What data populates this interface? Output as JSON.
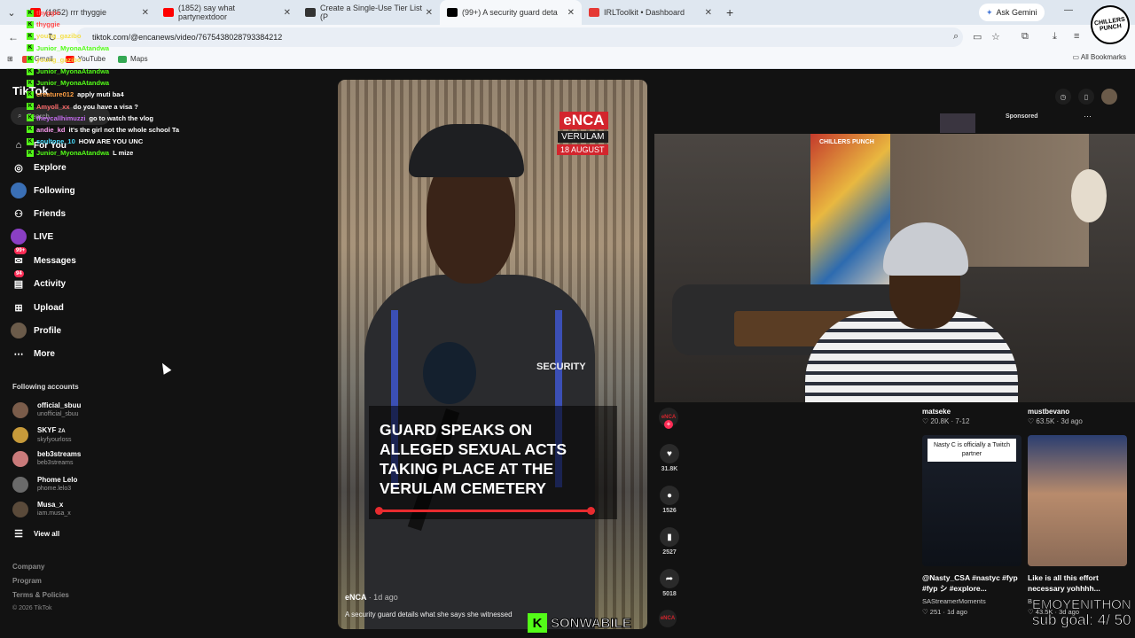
{
  "browser": {
    "tabs": [
      {
        "title": "(1852) rrr thyggie",
        "color": "#ff0000"
      },
      {
        "title": "(1852) say what partynextdoor",
        "color": "#ff0000"
      },
      {
        "title": "Create a Single-Use Tier List (P",
        "color": "#333333"
      },
      {
        "title": "(99+) A security guard deta",
        "color": "#000000"
      },
      {
        "title": "IRLToolkit • Dashboard",
        "color": "#e53935"
      }
    ],
    "new_tab": "+",
    "ask_gemini": "Ask Gemini",
    "url": "tiktok.com/@encanews/video/7675438028793384212",
    "bookmarks": [
      "Gmail",
      "YouTube",
      "Maps"
    ],
    "all_bookmarks": "All Bookmarks"
  },
  "chat": [
    {
      "user": "thyggie",
      "msg": "",
      "color": "#ff4d4d"
    },
    {
      "user": "thyggie",
      "msg": "",
      "color": "#ff4d4d"
    },
    {
      "user": "young_gazibo",
      "msg": "",
      "color": "#f4e04d"
    },
    {
      "user": "Junior_MyonaAtandwa",
      "msg": "",
      "color": "#53fc18"
    },
    {
      "user": "young_gazibo",
      "msg": "",
      "color": "#f4e04d"
    },
    {
      "user": "Junior_MyonaAtandwa",
      "msg": "",
      "color": "#53fc18"
    },
    {
      "user": "Junior_MyonaAtandwa",
      "msg": "",
      "color": "#53fc18"
    },
    {
      "user": "creature012",
      "msg": "apply muti ba4",
      "color": "#ff9f43"
    },
    {
      "user": "Amyoll_xx",
      "msg": "do you have a visa ?",
      "color": "#ff6b6b"
    },
    {
      "user": "theycallhimuzzi",
      "msg": "go to watch the vlog",
      "color": "#c56cf0"
    },
    {
      "user": "andie_kd",
      "msg": "it's the girl not the whole school Ta",
      "color": "#ff9ff3"
    },
    {
      "user": "soultone_10",
      "msg": "HOW ARE YOU UNC",
      "color": "#48dbfb"
    },
    {
      "user": "Junior_MyonaAtandwa",
      "msg": "L mize",
      "color": "#53fc18"
    }
  ],
  "sidebar": {
    "logo": "TikTok",
    "search_placeholder": "Search",
    "items": [
      {
        "label": "For You",
        "icon": "home-icon"
      },
      {
        "label": "Explore",
        "icon": "compass-icon"
      },
      {
        "label": "Following",
        "icon": "following-icon"
      },
      {
        "label": "Friends",
        "icon": "friends-icon"
      },
      {
        "label": "LIVE",
        "icon": "live-icon"
      },
      {
        "label": "Messages",
        "icon": "messages-icon",
        "badge": "99+"
      },
      {
        "label": "Activity",
        "icon": "activity-icon",
        "badge": "94"
      },
      {
        "label": "Upload",
        "icon": "upload-icon"
      },
      {
        "label": "Profile",
        "icon": "profile-icon"
      },
      {
        "label": "More",
        "icon": "more-icon"
      }
    ],
    "following_title": "Following accounts",
    "accounts": [
      {
        "name": "official_sbuu",
        "handle": "unofficial_sbuu",
        "color": "#7a5c4a"
      },
      {
        "name": "SKYF",
        "tag": "ZA",
        "handle": "skyfyourloss",
        "color": "#c79a3a"
      },
      {
        "name": "beb3streams",
        "handle": "beb3streams",
        "color": "#c97a7a"
      },
      {
        "name": "Phome Lelo",
        "handle": "phome.lelo3",
        "color": "#6a6a6a"
      },
      {
        "name": "Musa_x",
        "handle": "iam.musa_x",
        "color": "#5a4a3a"
      }
    ],
    "view_all": "View all",
    "footer": [
      "Company",
      "Program",
      "Terms & Policies",
      "© 2026 TikTok"
    ]
  },
  "video": {
    "brand": "eNCA",
    "location": "VERULAM",
    "date": "18 AUGUST",
    "vest_label": "SECURITY",
    "headline": "GUARD SPEAKS ON ALLEGED SEXUAL ACTS TAKING PLACE AT THE VERULAM CEMETERY",
    "author": "eNCA",
    "age": "· 1d ago",
    "description": "A security guard details what she says she witnessed",
    "actions": [
      {
        "icon": "heart-icon",
        "count": "31.8K"
      },
      {
        "icon": "comment-icon",
        "count": "1526"
      },
      {
        "icon": "bookmark-icon",
        "count": "2527"
      },
      {
        "icon": "share-icon",
        "count": "5018"
      }
    ]
  },
  "webcam": {
    "poster_text": "CHILLERS PUNCH"
  },
  "right": {
    "sponsored": "Sponsored",
    "cards": [
      {
        "user": "matseke",
        "stats": "♡ 20.8K · 7-12"
      },
      {
        "user": "mustbevano",
        "stats": "♡ 63.5K · 3d ago"
      }
    ],
    "thumbs": [
      {
        "note": "Nasty C is officially a Twitch partner",
        "caption": "@Nasty_CSA #nastyc #fyp #fyp シ #explore...",
        "user": "SAStreamerMoments",
        "stats": "♡ 251 · 1d ago"
      },
      {
        "caption": "Like is all this effort necessary yohhhh...",
        "user": "B",
        "stats": "♡ 43.5K · 3d ago"
      }
    ]
  },
  "overlays": {
    "kick_user": "SONWABILE",
    "stream_title": "EMOYENITHON",
    "sub_goal": "sub goal: 4/ 50",
    "badge": "CHILLERS PUNCH"
  }
}
